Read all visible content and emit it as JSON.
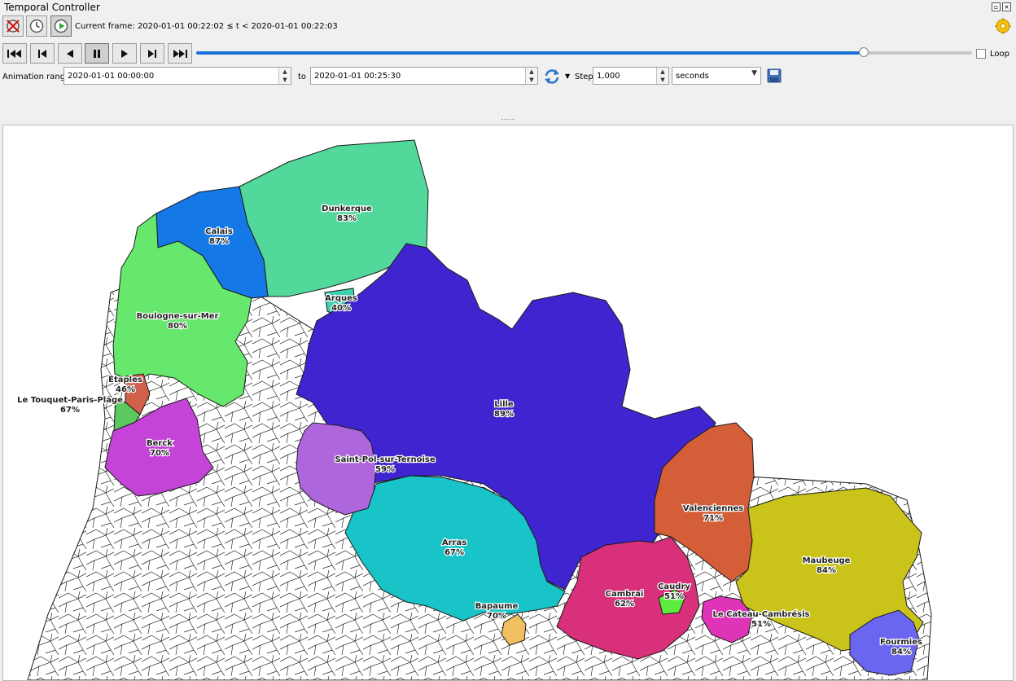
{
  "window": {
    "title": "Temporal Controller"
  },
  "controller": {
    "current_frame_label": "Current frame: 2020-01-01 00:22:02 ≤ t < 2020-01-01 00:22:03",
    "slider_position": 0.86,
    "loop_label": "Loop",
    "loop_checked": false,
    "animation_range_label": "Animation range",
    "range_start": "2020-01-01 00:00:00",
    "to_label": "to",
    "range_end": "2020-01-01 00:25:30",
    "step_label": "Step",
    "step_value": "1,000",
    "step_unit": "seconds"
  },
  "icons": {
    "disable": "disable-temporal-icon",
    "fixed": "clock-icon",
    "animated": "play-mode-icon",
    "settings": "gear-icon",
    "refresh": "refresh-icon",
    "save": "save-icon"
  },
  "map": {
    "regions": [
      {
        "name": "Dunkerque",
        "percent": "83%",
        "color": "#52d89a"
      },
      {
        "name": "Calais",
        "percent": "87%",
        "color": "#1478e6"
      },
      {
        "name": "Boulogne-sur-Mer",
        "percent": "80%",
        "color": "#66e86c"
      },
      {
        "name": "Arques",
        "percent": "40%",
        "color": "#3fd0b0"
      },
      {
        "name": "Lille",
        "percent": "89%",
        "color": "#3f25d0"
      },
      {
        "name": "Étaples",
        "percent": "46%",
        "color": "#d0604a"
      },
      {
        "name": "Le Touquet-Paris-Plage",
        "percent": "67%",
        "color": "#5cc860"
      },
      {
        "name": "Berck",
        "percent": "70%",
        "color": "#c444d8"
      },
      {
        "name": "Saint-Pol-sur-Ternoise",
        "percent": "59%",
        "color": "#ae66dc"
      },
      {
        "name": "Arras",
        "percent": "67%",
        "color": "#18c4c8"
      },
      {
        "name": "Valenciennes",
        "percent": "71%",
        "color": "#d45e38"
      },
      {
        "name": "Maubeuge",
        "percent": "84%",
        "color": "#cac41a"
      },
      {
        "name": "Cambrai",
        "percent": "62%",
        "color": "#d8307a"
      },
      {
        "name": "Caudry",
        "percent": "51%",
        "color": "#5cec3c"
      },
      {
        "name": "Bapaume",
        "percent": "70%",
        "color": "#f0c060"
      },
      {
        "name": "Le Cateau-Cambrésis",
        "percent": "51%",
        "color": "#e034b8"
      },
      {
        "name": "Fourmies",
        "percent": "84%",
        "color": "#6a66f0"
      }
    ]
  }
}
